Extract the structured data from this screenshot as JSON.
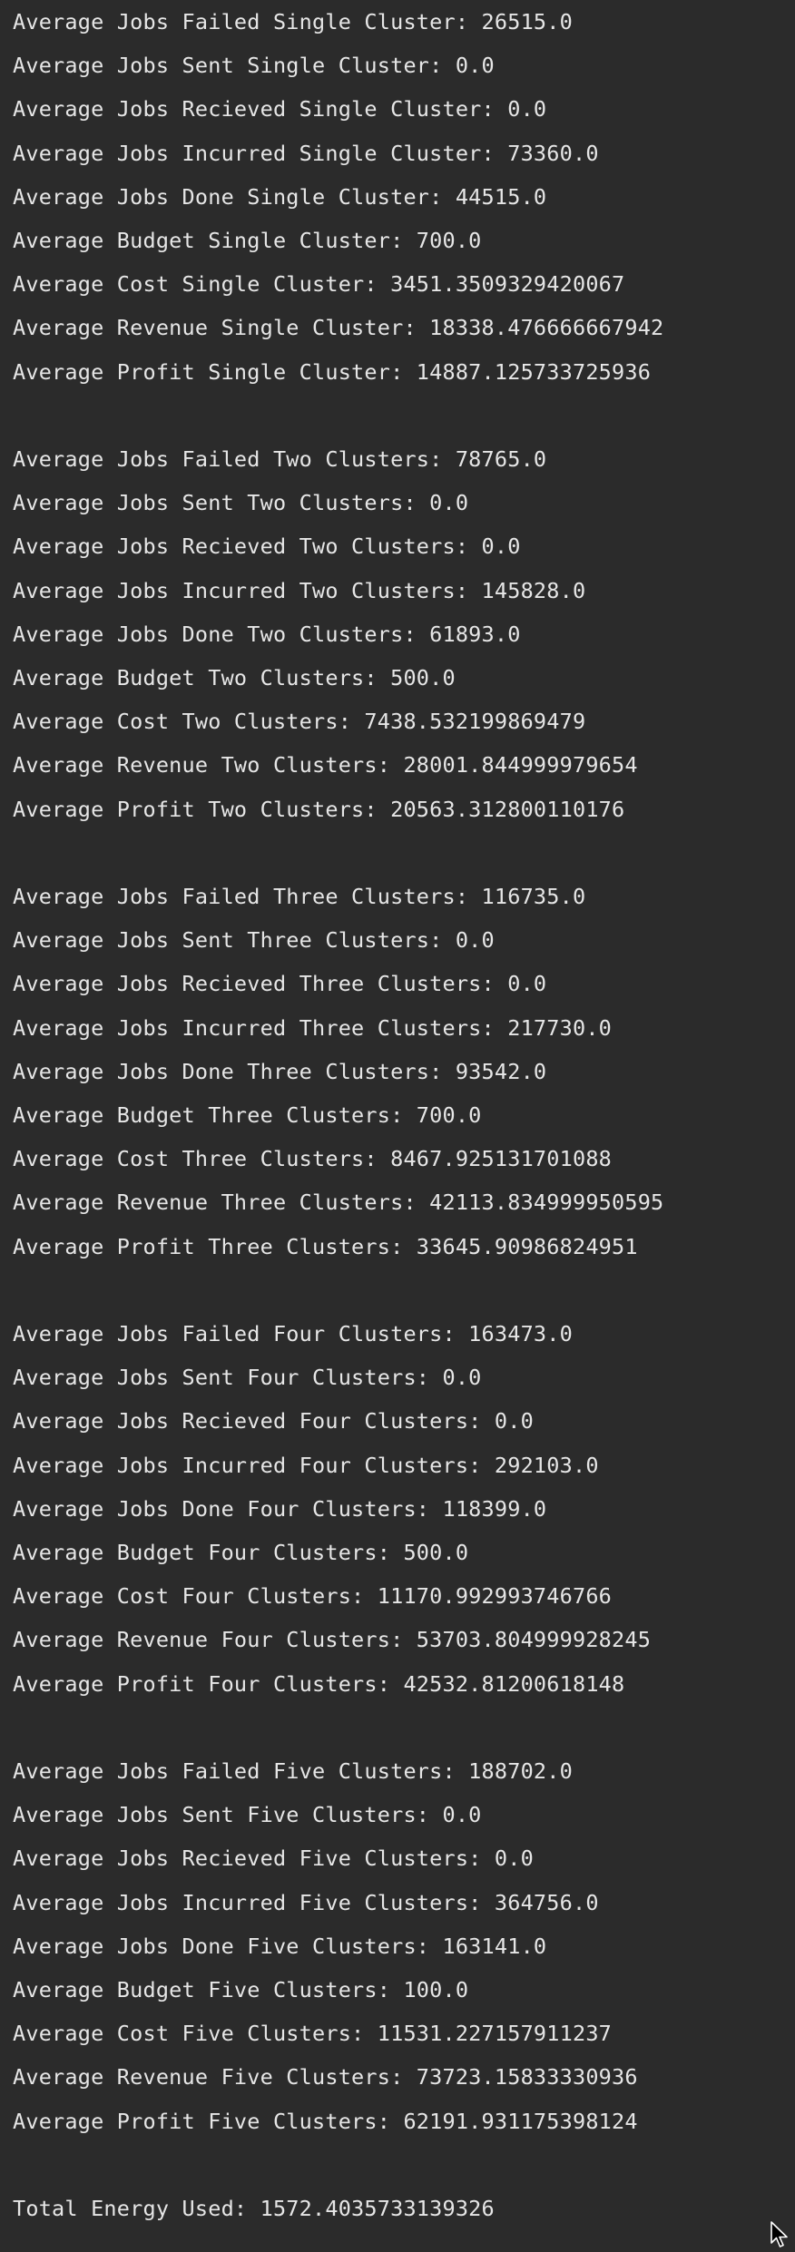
{
  "console": {
    "lines": [
      "Average Jobs Failed Single Cluster: 26515.0",
      "Average Jobs Sent Single Cluster: 0.0",
      "Average Jobs Recieved Single Cluster: 0.0",
      "Average Jobs Incurred Single Cluster: 73360.0",
      "Average Jobs Done Single Cluster: 44515.0",
      "Average Budget Single Cluster: 700.0",
      "Average Cost Single Cluster: 3451.3509329420067",
      "Average Revenue Single Cluster: 18338.476666667942",
      "Average Profit Single Cluster: 14887.125733725936",
      "",
      "Average Jobs Failed Two Clusters: 78765.0",
      "Average Jobs Sent Two Clusters: 0.0",
      "Average Jobs Recieved Two Clusters: 0.0",
      "Average Jobs Incurred Two Clusters: 145828.0",
      "Average Jobs Done Two Clusters: 61893.0",
      "Average Budget Two Clusters: 500.0",
      "Average Cost Two Clusters: 7438.532199869479",
      "Average Revenue Two Clusters: 28001.844999979654",
      "Average Profit Two Clusters: 20563.312800110176",
      "",
      "Average Jobs Failed Three Clusters: 116735.0",
      "Average Jobs Sent Three Clusters: 0.0",
      "Average Jobs Recieved Three Clusters: 0.0",
      "Average Jobs Incurred Three Clusters: 217730.0",
      "Average Jobs Done Three Clusters: 93542.0",
      "Average Budget Three Clusters: 700.0",
      "Average Cost Three Clusters: 8467.925131701088",
      "Average Revenue Three Clusters: 42113.834999950595",
      "Average Profit Three Clusters: 33645.90986824951",
      "",
      "Average Jobs Failed Four Clusters: 163473.0",
      "Average Jobs Sent Four Clusters: 0.0",
      "Average Jobs Recieved Four Clusters: 0.0",
      "Average Jobs Incurred Four Clusters: 292103.0",
      "Average Jobs Done Four Clusters: 118399.0",
      "Average Budget Four Clusters: 500.0",
      "Average Cost Four Clusters: 11170.992993746766",
      "Average Revenue Four Clusters: 53703.804999928245",
      "Average Profit Four Clusters: 42532.81200618148",
      "",
      "Average Jobs Failed Five Clusters: 188702.0",
      "Average Jobs Sent Five Clusters: 0.0",
      "Average Jobs Recieved Five Clusters: 0.0",
      "Average Jobs Incurred Five Clusters: 364756.0",
      "Average Jobs Done Five Clusters: 163141.0",
      "Average Budget Five Clusters: 100.0",
      "Average Cost Five Clusters: 11531.227157911237",
      "Average Revenue Five Clusters: 73723.15833330936",
      "Average Profit Five Clusters: 62191.931175398124",
      "",
      "Total Energy Used: 1572.4035733139326"
    ]
  },
  "colors": {
    "background": "#2b2b2b",
    "text": "#e6e6e6"
  },
  "icons": {
    "cursor": "mouse-pointer-icon"
  }
}
